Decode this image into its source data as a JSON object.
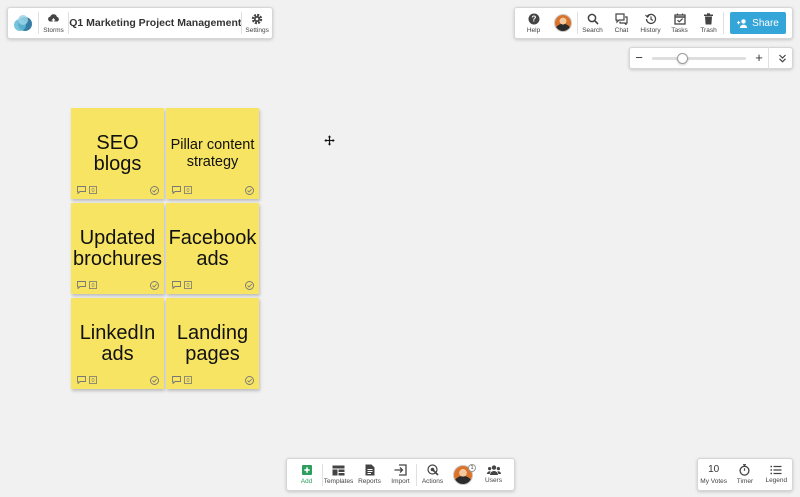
{
  "header": {
    "storms_label": "Storms",
    "board_title": "Q1 Marketing Project Management",
    "settings_label": "Settings"
  },
  "toolbar": {
    "help_label": "Help",
    "search_label": "Search",
    "chat_label": "Chat",
    "history_label": "History",
    "tasks_label": "Tasks",
    "trash_label": "Trash",
    "share_label": "Share",
    "accent_color": "#34a5d8"
  },
  "zoom": {
    "minus": "−",
    "plus": "+",
    "level_fraction": 0.3
  },
  "notes": [
    {
      "text": "SEO blogs",
      "count": "0"
    },
    {
      "text": "Pillar content strategy",
      "count": "0"
    },
    {
      "text": "Updated brochures",
      "count": "0"
    },
    {
      "text": "Facebook ads",
      "count": "0"
    },
    {
      "text": "LinkedIn ads",
      "count": "0"
    },
    {
      "text": "Landing pages",
      "count": "0"
    }
  ],
  "note_color": "#f7e463",
  "bottom_toolbar": {
    "add_label": "Add",
    "templates_label": "Templates",
    "reports_label": "Reports",
    "import_label": "Import",
    "actions_label": "Actions",
    "users_badge": "1",
    "users_label": "Users"
  },
  "bottom_right": {
    "votes_count": "10",
    "votes_label": "My Votes",
    "timer_label": "Timer",
    "legend_label": "Legend"
  }
}
